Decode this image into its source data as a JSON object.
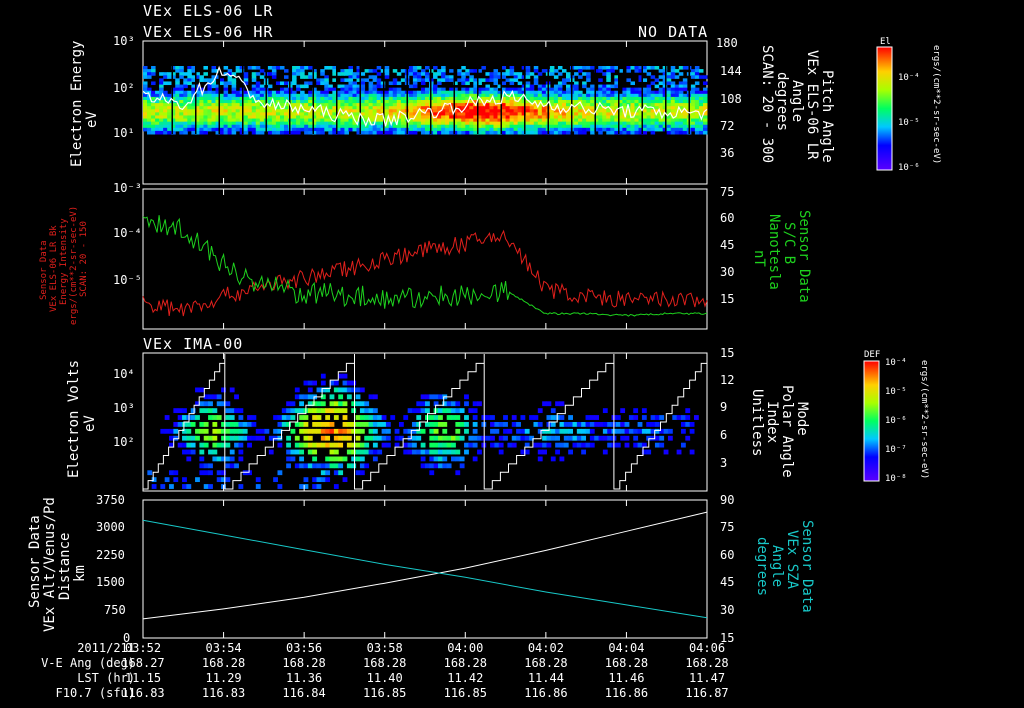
{
  "header": {
    "line1": "VEx ELS-06 LR",
    "line2": "VEx ELS-06 HR",
    "no_data": "NO DATA"
  },
  "panel1": {
    "ylabel": "Electron Energy",
    "yunit": "eV",
    "yticks": [
      "10³",
      "10²",
      "10¹"
    ],
    "rticks": [
      "180",
      "144",
      "108",
      "72",
      "36"
    ],
    "rlabel": [
      "Pitch Angle",
      "VEx ELS-06 LR",
      "Angle",
      "degrees",
      "SCAN: 20 - 300"
    ],
    "cbar_title": "El",
    "cbar_ticks": [
      "10⁻⁴",
      "10⁻⁵",
      "10⁻⁶"
    ],
    "cbar_unit": "ergs/(cm**2-sr-sec-eV)"
  },
  "panel2": {
    "yticks": [
      "10⁻³",
      "10⁻⁴",
      "10⁻⁵"
    ],
    "rticks": [
      "75",
      "60",
      "45",
      "30",
      "15"
    ],
    "llabel": [
      "Sensor Data",
      "VEx ELS-06 LR Bk",
      "Energy Intensity",
      "ergs/(cm**2-sr-sec-eV)",
      "SCAN: 20 - 150"
    ],
    "rlabel": [
      "Sensor Data",
      "S/C B",
      "Nanotesla",
      "nT"
    ]
  },
  "panel3": {
    "title": "VEx IMA-00",
    "ylabel": "Electron Volts",
    "yunit": "eV",
    "yticks": [
      "10⁴",
      "10³",
      "10²"
    ],
    "rticks": [
      "15",
      "12",
      "9",
      "6",
      "3"
    ],
    "rlabel": [
      "Mode",
      "Polar Angle",
      "Index",
      "Unitless"
    ],
    "cbar_title": "DEF",
    "cbar_ticks": [
      "10⁻⁴",
      "10⁻⁵",
      "10⁻⁶",
      "10⁻⁷",
      "10⁻⁸"
    ],
    "cbar_unit": "ergs/(cm**2-sr-sec-eV)"
  },
  "panel4": {
    "llabel": [
      "Sensor Data",
      "VEx Alt/Venus/Pd",
      "Distance",
      "km"
    ],
    "rlabel": [
      "Sensor Data",
      "VEx SZA",
      "Angle",
      "degrees"
    ],
    "yticks": [
      "3750",
      "3000",
      "2250",
      "1500",
      "750",
      "0"
    ],
    "rticks": [
      "90",
      "75",
      "60",
      "45",
      "30",
      "15"
    ]
  },
  "footer": {
    "row_labels": [
      "2011/211",
      "V-E Ang (deg)",
      "LST (hr)",
      "F10.7 (sfu)"
    ],
    "times": [
      "03:52",
      "03:54",
      "03:56",
      "03:58",
      "04:00",
      "04:02",
      "04:04",
      "04:06"
    ],
    "ve_ang": [
      "168.27",
      "168.28",
      "168.28",
      "168.28",
      "168.28",
      "168.28",
      "168.28",
      "168.28"
    ],
    "lst": [
      "11.15",
      "11.29",
      "11.36",
      "11.40",
      "11.42",
      "11.44",
      "11.46",
      "11.47"
    ],
    "f107": [
      "116.83",
      "116.83",
      "116.84",
      "116.85",
      "116.85",
      "116.86",
      "116.86",
      "116.87"
    ]
  },
  "colors": {
    "red": "#e0201c",
    "green": "#1ed21e",
    "cyan": "#18c8c8",
    "white": "#ffffff"
  },
  "chart_data": [
    {
      "type": "heatmap",
      "xlabel": "",
      "ylabel": "Electron Energy eV",
      "x_range": [
        "03:52",
        "04:06"
      ],
      "ylim": [
        1,
        1000
      ],
      "y_scale": "log",
      "series": [
        {
          "name": "Pitch Angle",
          "x": [
            "03:52",
            "03:53",
            "03:54",
            "03:55",
            "03:56",
            "03:57",
            "03:58",
            "03:59",
            "04:00",
            "04:01",
            "04:02",
            "04:03",
            "04:04",
            "04:05",
            "04:06"
          ],
          "values": [
            110,
            100,
            145,
            100,
            95,
            85,
            80,
            90,
            100,
            110,
            100,
            95,
            92,
            90,
            90
          ]
        }
      ]
    },
    {
      "type": "line",
      "x_range": [
        "03:52",
        "04:06"
      ],
      "series": [
        {
          "name": "VEx ELS-06 LR Bk Energy Intensity",
          "x": [
            "03:52",
            "03:53",
            "03:54",
            "03:55",
            "03:56",
            "03:57",
            "03:58",
            "03:59",
            "04:00",
            "04:01",
            "04:02",
            "04:03",
            "04:04",
            "04:05",
            "04:06"
          ],
          "values": [
            5e-06,
            4e-06,
            7e-06,
            1.2e-05,
            1.6e-05,
            2.5e-05,
            4e-05,
            6e-05,
            8e-05,
            0.00012,
            1e-05,
            7e-06,
            6e-06,
            6e-06,
            6e-06
          ]
        },
        {
          "name": "S/C B",
          "x": [
            "03:52",
            "03:53",
            "03:54",
            "03:55",
            "03:56",
            "03:57",
            "03:58",
            "03:59",
            "04:00",
            "04:01",
            "04:02",
            "04:03",
            "04:04",
            "04:05",
            "04:06"
          ],
          "values": [
            57,
            55,
            35,
            25,
            20,
            20,
            18,
            18,
            20,
            22,
            10,
            10,
            9,
            10,
            10
          ]
        }
      ]
    },
    {
      "type": "heatmap",
      "ylabel": "Electron Volts eV",
      "x_range": [
        "03:52",
        "04:06"
      ],
      "y_scale": "log",
      "series": [
        {
          "name": "Polar Angle Index",
          "pattern": "sawtooth",
          "ylim": [
            0,
            15
          ]
        }
      ]
    },
    {
      "type": "line",
      "x_range": [
        "03:52",
        "04:06"
      ],
      "series": [
        {
          "name": "Distance",
          "x": [
            "03:52",
            "03:54",
            "03:56",
            "03:58",
            "04:00",
            "04:02",
            "04:04",
            "04:06"
          ],
          "values": [
            520,
            790,
            1110,
            1490,
            1900,
            2380,
            2900,
            3420
          ],
          "ylim": [
            0,
            3750
          ]
        },
        {
          "name": "VEx SZA",
          "x": [
            "03:52",
            "03:54",
            "03:56",
            "03:58",
            "04:00",
            "04:02",
            "04:04",
            "04:06"
          ],
          "values": [
            79,
            71,
            63,
            55,
            48,
            40,
            33,
            26
          ],
          "ylim": [
            15,
            90
          ]
        }
      ]
    }
  ]
}
